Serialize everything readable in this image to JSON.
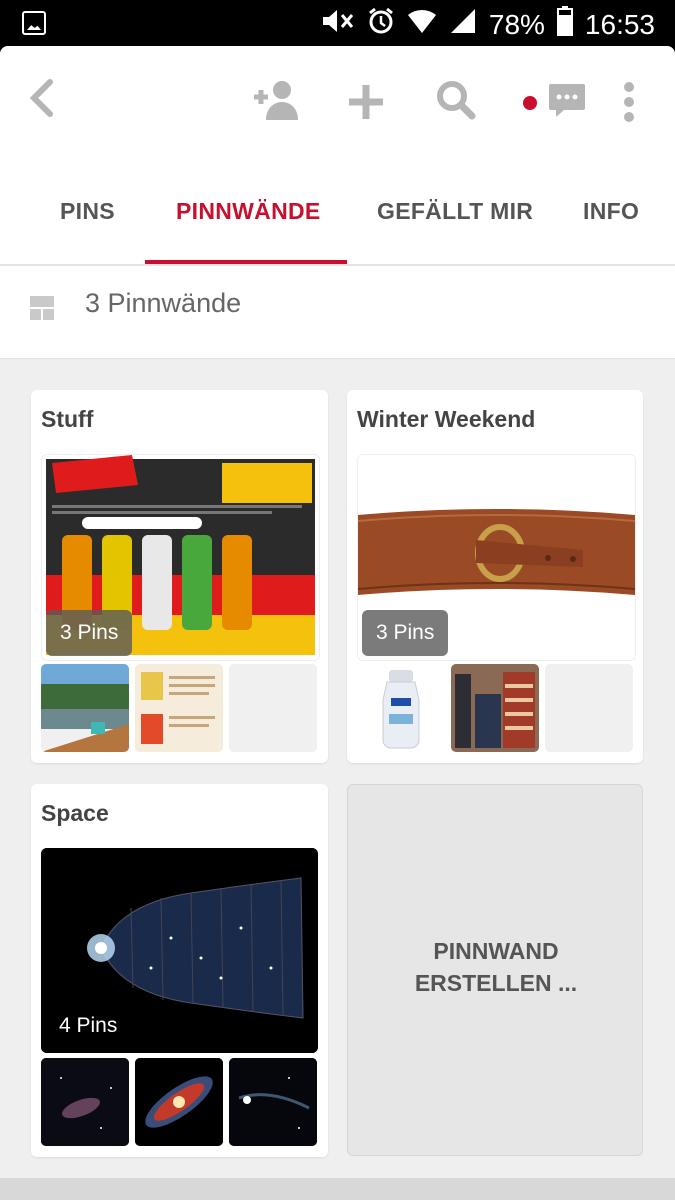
{
  "status_bar": {
    "battery": "78%",
    "time": "16:53",
    "icons": [
      "image-icon",
      "mute-icon",
      "alarm-icon",
      "wifi-icon",
      "signal-icon",
      "battery-icon"
    ]
  },
  "toolbar": {
    "icons": [
      "back-icon",
      "add-user-icon",
      "plus-icon",
      "search-icon",
      "notification-dot",
      "messages-icon",
      "more-icon"
    ]
  },
  "tabs": [
    {
      "label": "PINS",
      "active": false
    },
    {
      "label": "PINNWÄNDE",
      "active": true
    },
    {
      "label": "GEFÄLLT MIR",
      "active": false
    },
    {
      "label": "INFO",
      "active": false
    }
  ],
  "boards_count": "3 Pinnwände",
  "boards": [
    {
      "title": "Stuff",
      "pins": "3 Pins"
    },
    {
      "title": "Winter Weekend",
      "pins": "3 Pins"
    },
    {
      "title": "Space",
      "pins": "4 Pins"
    }
  ],
  "create_board": {
    "line1": "PINNWAND",
    "line2": "ERSTELLEN ..."
  },
  "colors": {
    "accent": "#c8102e",
    "icon_gray": "#b5b5b5",
    "background": "#efefef"
  }
}
